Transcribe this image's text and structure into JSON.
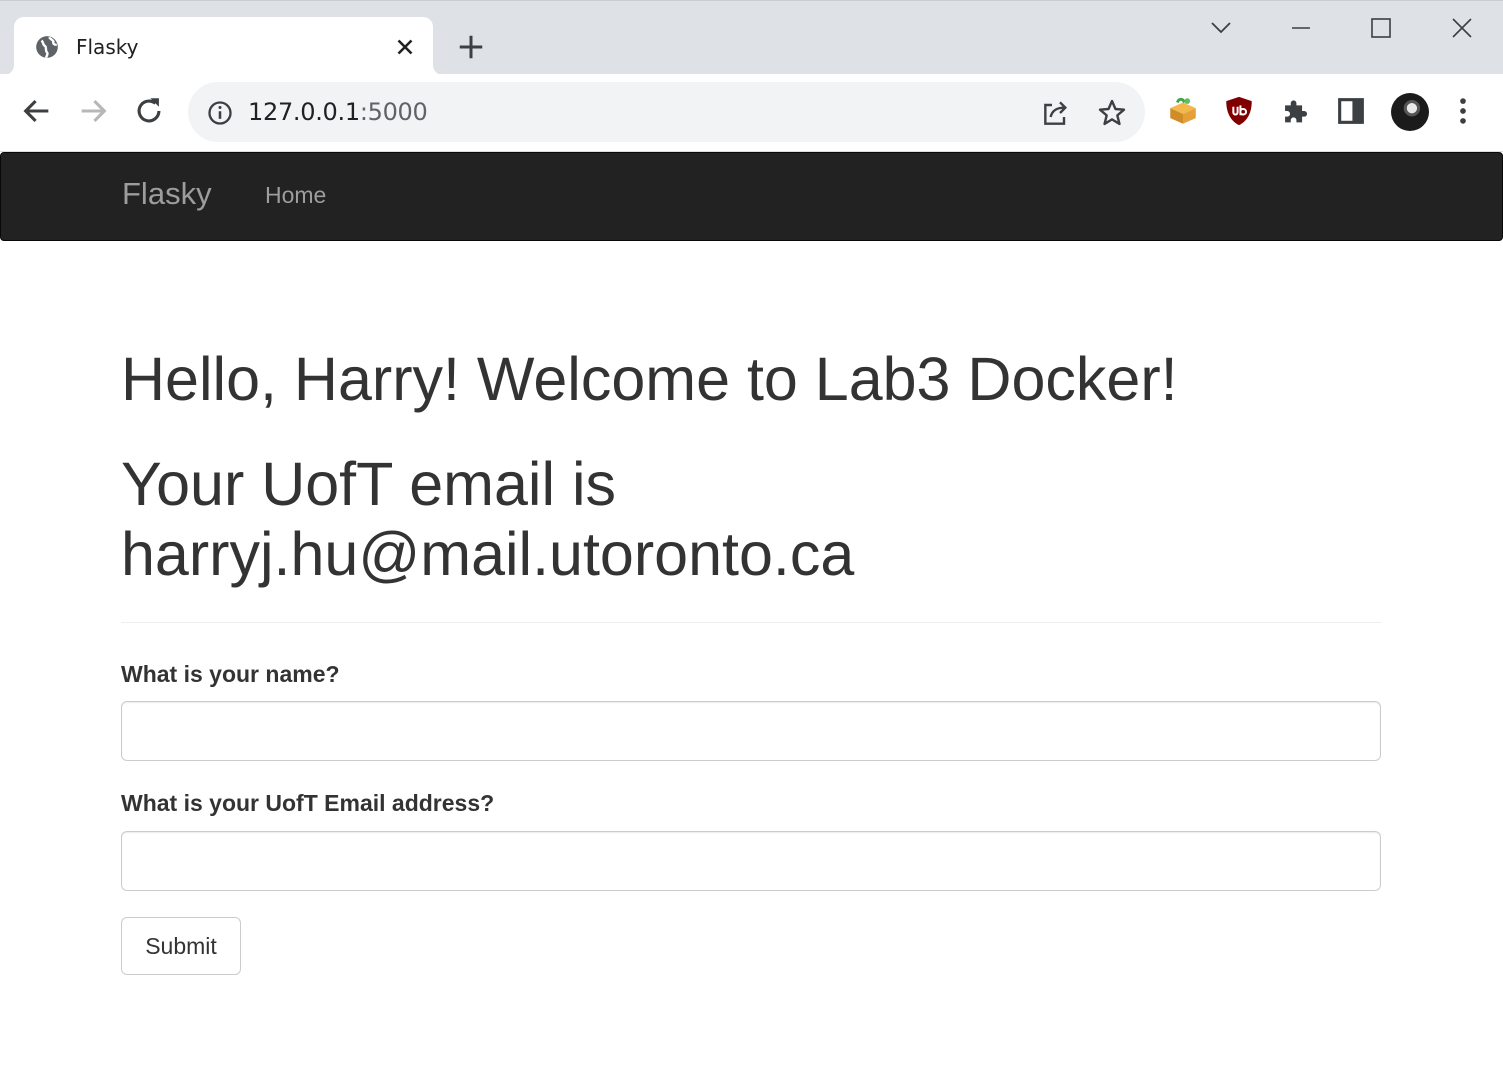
{
  "browser": {
    "tab": {
      "title": "Flasky"
    },
    "address_bar": {
      "host": "127.0.0.1",
      "port": ":5000"
    }
  },
  "navbar": {
    "brand": "Flasky",
    "links": [
      {
        "label": "Home"
      }
    ]
  },
  "page": {
    "greeting": "Hello, Harry! Welcome to Lab3 Docker!",
    "email_line1": "Your UofT email is",
    "email_line2": "harryj.hu@mail.utoronto.ca"
  },
  "form": {
    "name_label": "What is your name?",
    "name_value": "",
    "email_label": "What is your UofT Email address?",
    "email_value": "",
    "submit_label": "Submit"
  },
  "icons": {
    "tab_favicon": "globe-icon",
    "tab_close": "close-icon",
    "new_tab": "plus-icon",
    "tab_search": "chevron-down-icon",
    "minimize": "minimize-icon",
    "maximize": "maximize-icon",
    "close_window": "close-window-icon",
    "back": "back-arrow-icon",
    "forward": "forward-arrow-icon",
    "reload": "reload-icon",
    "site_info": "info-icon",
    "share": "share-icon",
    "bookmark": "star-icon",
    "extension_1": "extension-box-icon",
    "extension_2": "ublock-shield-icon",
    "extensions_menu": "puzzle-icon",
    "side_panel": "side-panel-icon",
    "profile": "avatar",
    "menu": "kebab-menu-icon"
  },
  "colors": {
    "navbar_bg": "#222222",
    "navbar_text": "#9d9d9d",
    "heading_text": "#333333",
    "tabstrip_bg": "#dee1e6",
    "omnibox_bg": "#f1f3f4",
    "ublock_red": "#800000"
  }
}
